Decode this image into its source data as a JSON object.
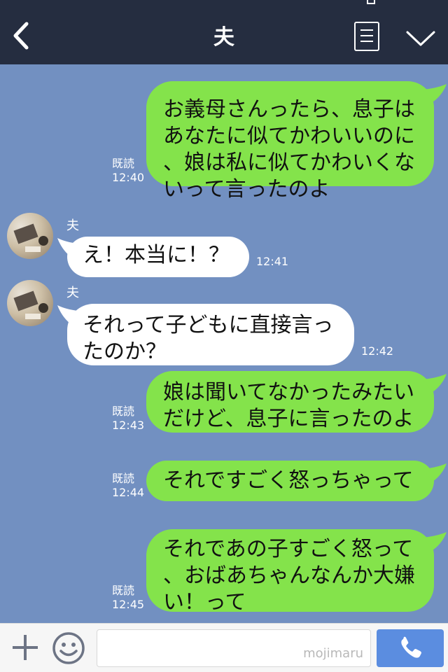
{
  "header": {
    "title": "夫"
  },
  "messages": [
    {
      "side": "out",
      "text": "お義母さんったら、息子は\nあなたに似てかわいいのに\n、娘は私に似てかわいくな\nいって言ったのよ",
      "read": "既読",
      "time": "12:40"
    },
    {
      "side": "in",
      "sender": "夫",
      "text": "え！本当に！？",
      "time": "12:41"
    },
    {
      "side": "in",
      "sender": "夫",
      "text": "それって子どもに直接言っ\nたのか？",
      "time": "12:42"
    },
    {
      "side": "out",
      "text": "娘は聞いてなかったみたい\nだけど、息子に言ったのよ",
      "read": "既読",
      "time": "12:43"
    },
    {
      "side": "out",
      "text": "それですごく怒っちゃって",
      "read": "既読",
      "time": "12:44"
    },
    {
      "side": "out",
      "text": "それであの子すごく怒って\n、おばあちゃんなんか大嫌\nい！って",
      "read": "既読",
      "time": "12:45"
    }
  ],
  "input": {
    "value": "",
    "watermark": "mojimaru"
  },
  "colors": {
    "header": "#252d40",
    "background": "#7290c1",
    "outgoing": "#84e34b",
    "incoming": "#ffffff",
    "send": "#5b8de0"
  },
  "icons": {
    "back": "chevron-left-icon",
    "menu": "notes-icon",
    "collapse": "chevron-down-icon",
    "plus": "plus-icon",
    "emoji": "smiley-icon",
    "call": "phone-icon"
  }
}
